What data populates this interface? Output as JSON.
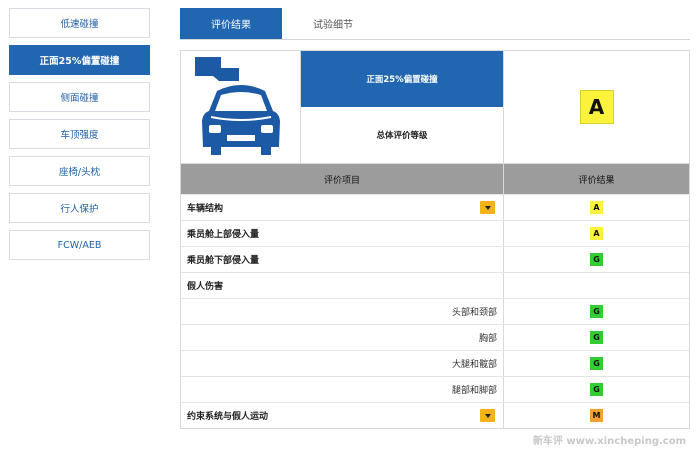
{
  "colors": {
    "accent": "#2066b0",
    "A": "#fbf23b",
    "G": "#33cc33",
    "M": "#f0a030"
  },
  "sidebar": {
    "items": [
      {
        "label": "低速碰撞",
        "active": false
      },
      {
        "label": "正面25%偏置碰撞",
        "active": true
      },
      {
        "label": "侧面碰撞",
        "active": false
      },
      {
        "label": "车顶强度",
        "active": false
      },
      {
        "label": "座椅/头枕",
        "active": false
      },
      {
        "label": "行人保护",
        "active": false
      },
      {
        "label": "FCW/AEB",
        "active": false
      }
    ]
  },
  "tabs": [
    {
      "label": "评价结果",
      "active": true
    },
    {
      "label": "试验细节",
      "active": false
    }
  ],
  "summary": {
    "test_name": "正面25%偏置碰撞",
    "overall_label": "总体评价等级",
    "overall_rating": "A"
  },
  "table": {
    "headers": [
      "评价项目",
      "评价结果"
    ],
    "rows": [
      {
        "name": "车辆结构",
        "rating": "A",
        "style": "bold",
        "dropdown": true
      },
      {
        "name": "乘员舱上部侵入量",
        "rating": "A",
        "style": "bold",
        "dropdown": false
      },
      {
        "name": "乘员舱下部侵入量",
        "rating": "G",
        "style": "bold",
        "dropdown": false
      },
      {
        "name": "假人伤害",
        "rating": "",
        "style": "bold",
        "dropdown": false
      },
      {
        "name": "头部和颈部",
        "rating": "G",
        "style": "sub",
        "dropdown": false
      },
      {
        "name": "胸部",
        "rating": "G",
        "style": "sub",
        "dropdown": false
      },
      {
        "name": "大腿和髋部",
        "rating": "G",
        "style": "sub",
        "dropdown": false
      },
      {
        "name": "腿部和脚部",
        "rating": "G",
        "style": "sub",
        "dropdown": false
      },
      {
        "name": "约束系统与假人运动",
        "rating": "M",
        "style": "bold",
        "dropdown": true
      }
    ]
  },
  "watermark": "新车评 www.xincheping.com",
  "icons": {
    "car": "car-front-crash-icon",
    "dropdown": "caret-down-icon"
  }
}
